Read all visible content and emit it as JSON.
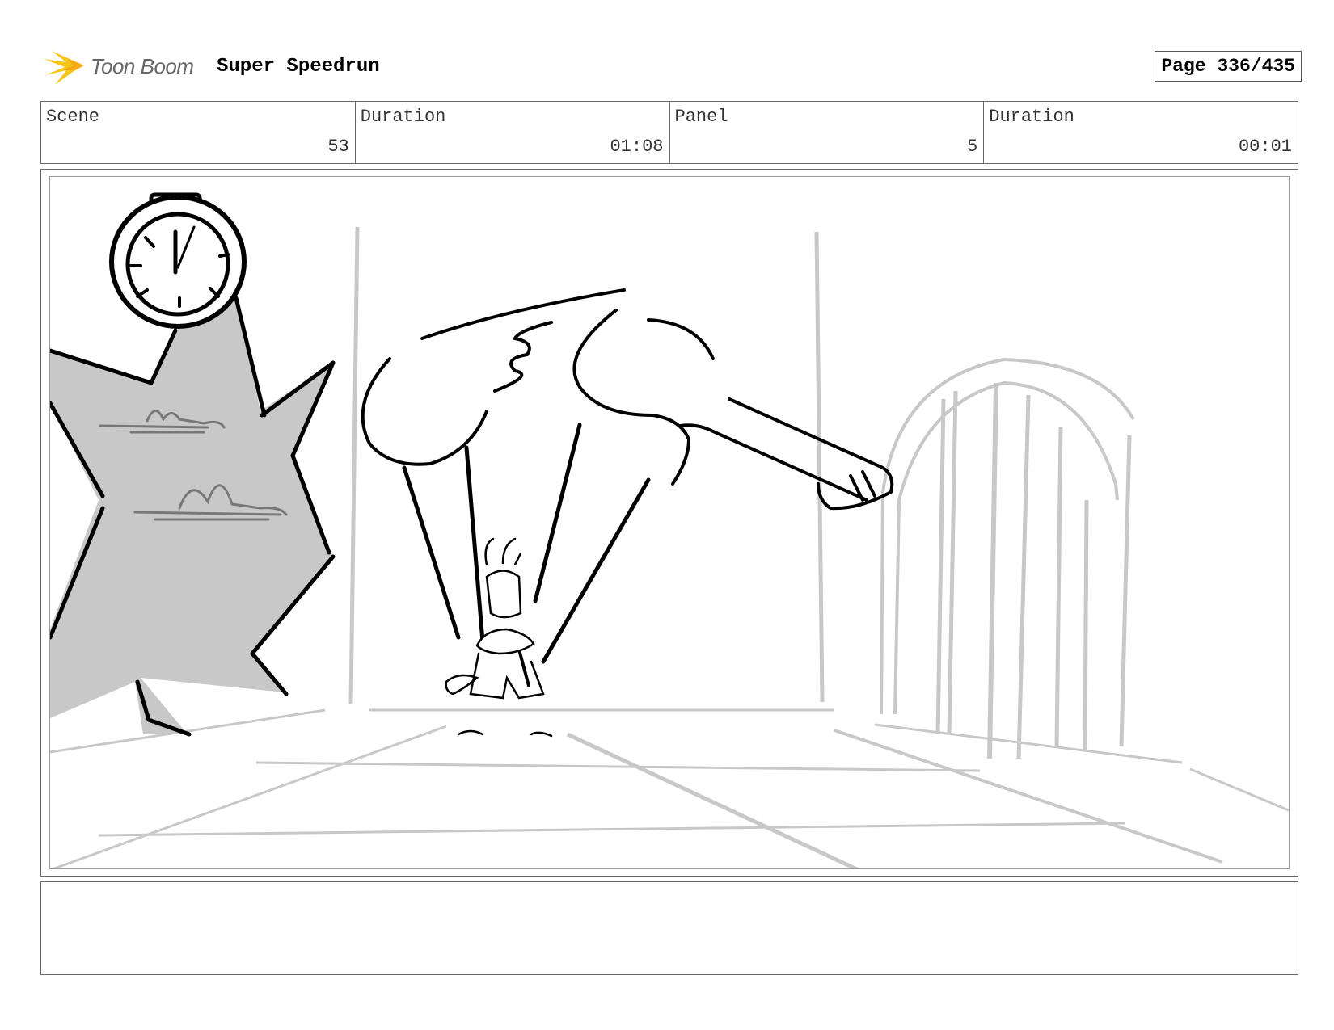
{
  "header": {
    "logo_text": "Toon Boom",
    "project_title": "Super Speedrun",
    "page_label": "Page 336/435"
  },
  "info": {
    "scene": {
      "label": "Scene",
      "value": "53"
    },
    "scene_duration": {
      "label": "Duration",
      "value": "01:08"
    },
    "panel": {
      "label": "Panel",
      "value": "5"
    },
    "panel_duration": {
      "label": "Duration",
      "value": "00:01"
    }
  },
  "notes": {
    "text": ""
  },
  "colors": {
    "logo_yellow": "#f5c518",
    "frame_border": "#666666",
    "sketch_gray": "#c8c8c8"
  }
}
